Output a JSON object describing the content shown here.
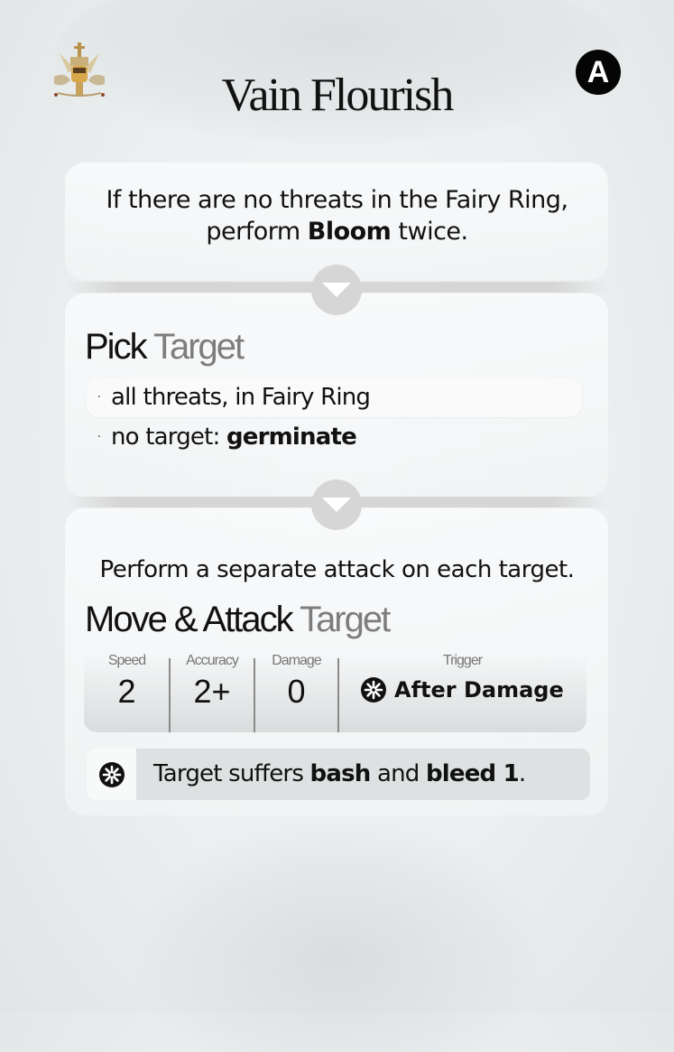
{
  "card": {
    "title": "Vain Flourish",
    "badge": "A",
    "emblem_icon": "royal-crest-icon"
  },
  "intro": {
    "text_before": "If there are no threats in the Fairy Ring, perform ",
    "bold": "Bloom",
    "text_after": " twice."
  },
  "connector_icon": "chevron-down-icon",
  "pick_target": {
    "heading_main": "Pick",
    "heading_muted": "Target",
    "options": [
      {
        "text": "all threats, in Fairy Ring",
        "bold": "",
        "highlighted": true
      },
      {
        "text": "no target: ",
        "bold": "germinate",
        "highlighted": false
      }
    ],
    "bullet": "·"
  },
  "attack": {
    "description": "Perform a separate attack on each target.",
    "heading_main": "Move & Attack",
    "heading_muted": "Target",
    "stats": {
      "speed": {
        "label": "Speed",
        "value": "2"
      },
      "accuracy": {
        "label": "Accuracy",
        "value": "2+"
      },
      "damage": {
        "label": "Damage",
        "value": "0"
      },
      "trigger": {
        "label": "Trigger",
        "value": "After Damage",
        "icon": "asterisk-trigger-icon"
      }
    },
    "effect": {
      "icon": "asterisk-trigger-icon",
      "t1": "Target suffers ",
      "b1": "bash",
      "t2": " and ",
      "b2": "bleed 1",
      "t3": "."
    }
  }
}
